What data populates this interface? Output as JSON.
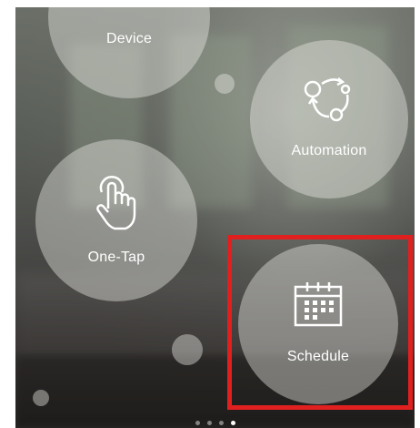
{
  "menu": {
    "device_label": "Device",
    "automation_label": "Automation",
    "one_tap_label": "One-Tap",
    "schedule_label": "Schedule"
  },
  "icons": {
    "automation": "automation-cycle-icon",
    "one_tap": "tap-hand-icon",
    "schedule": "calendar-icon"
  },
  "pager": {
    "page_count": 4,
    "active_index": 3
  },
  "colors": {
    "highlight": "#e0201f"
  }
}
